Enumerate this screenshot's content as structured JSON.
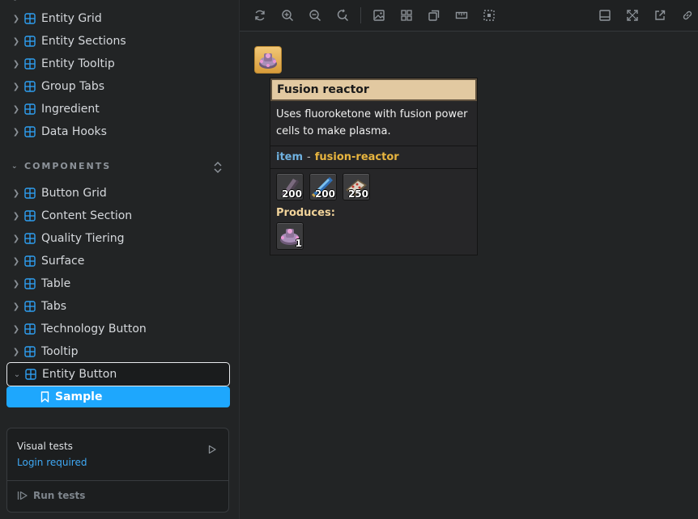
{
  "sidebar": {
    "top_items": [
      {
        "label": "Entity Grid"
      },
      {
        "label": "Entity Sections"
      },
      {
        "label": "Entity Tooltip"
      },
      {
        "label": "Group Tabs"
      },
      {
        "label": "Ingredient"
      },
      {
        "label": "Data Hooks"
      }
    ],
    "section_title": "COMPONENTS",
    "component_items": [
      {
        "label": "Button Grid"
      },
      {
        "label": "Content Section"
      },
      {
        "label": "Quality Tiering"
      },
      {
        "label": "Surface"
      },
      {
        "label": "Table"
      },
      {
        "label": "Tabs"
      },
      {
        "label": "Technology Button"
      },
      {
        "label": "Tooltip"
      },
      {
        "label": "Entity Button"
      }
    ],
    "story": {
      "label": "Sample"
    }
  },
  "visual_tests": {
    "title": "Visual tests",
    "login_label": "Login required",
    "run_label": "Run tests"
  },
  "toolbar": {
    "icons": [
      "reload-icon",
      "zoom-in-icon",
      "zoom-out-icon",
      "reset-zoom-icon",
      "background-icon",
      "grid-icon",
      "viewport-icon",
      "measure-icon",
      "outline-icon",
      "panel-toggle-icon",
      "fullscreen-icon",
      "open-new-tab-icon",
      "copy-link-icon"
    ]
  },
  "preview": {
    "tooltip": {
      "title": "Fusion reactor",
      "description": "Uses fluoroketone with fusion power cells to make plasma.",
      "type_kind": "item",
      "type_separator": "-",
      "type_name": "fusion-reactor",
      "ingredients": [
        {
          "icon": "plate-icon",
          "count": "200"
        },
        {
          "icon": "superconductor-icon",
          "count": "200"
        },
        {
          "icon": "circuit-icon",
          "count": "250"
        }
      ],
      "produces_label": "Produces:",
      "products": [
        {
          "icon": "fusion-reactor-icon",
          "count": "1"
        }
      ]
    }
  },
  "colors": {
    "accent": "#1ea7fd",
    "link": "#3fa9f5",
    "tooltip_header": "#e2c9a1",
    "item_kind": "#6fb1e0",
    "item_name": "#e8b53f"
  }
}
